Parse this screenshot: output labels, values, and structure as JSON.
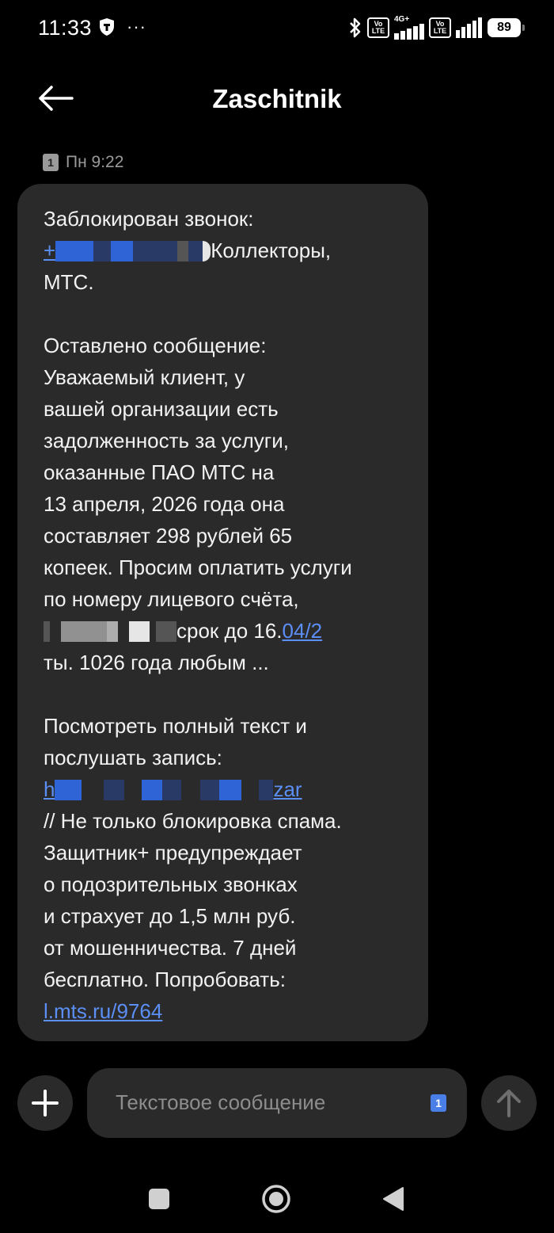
{
  "status_bar": {
    "time": "11:33",
    "dots": "···",
    "volte_label": "Vo\nLTE",
    "network_label": "4G+",
    "battery": "89"
  },
  "header": {
    "title": "Zaschitnik"
  },
  "message": {
    "sim": "1",
    "time": "Пн 9:22",
    "lines": [
      "Заблокирован звонок:",
      "Коллекторы,",
      "МТС.",
      "Оставлено сообщение:",
      "Уважаемый клиент, у",
      "вашей организации есть",
      "задолженность за услуги,",
      "оказанные ПАО МТС на",
      "13 апреля, 2026 года она",
      "составляет 298 рублей 65",
      "копеек. Просим оплатить услуги",
      "по номеру лицевого счёта,",
      "срок до 16.",
      "04/2",
      "ты. 1026 года любым ...",
      "Посмотреть полный текст и",
      "послушать запись:",
      "// Не только блокировка спама.",
      "Защитник+ предупреждает",
      "о подозрительных звонках",
      "и страхует до 1,5 млн руб.",
      "от мошенничества. 7 дней",
      "бесплатно. Попробовать:",
      "l.mts.ru/9764"
    ],
    "phone_prefix": "+",
    "link_prefix": "h",
    "link_suffix": "zar"
  },
  "composer": {
    "placeholder": "Текстовое сообщение",
    "sim": "1"
  }
}
